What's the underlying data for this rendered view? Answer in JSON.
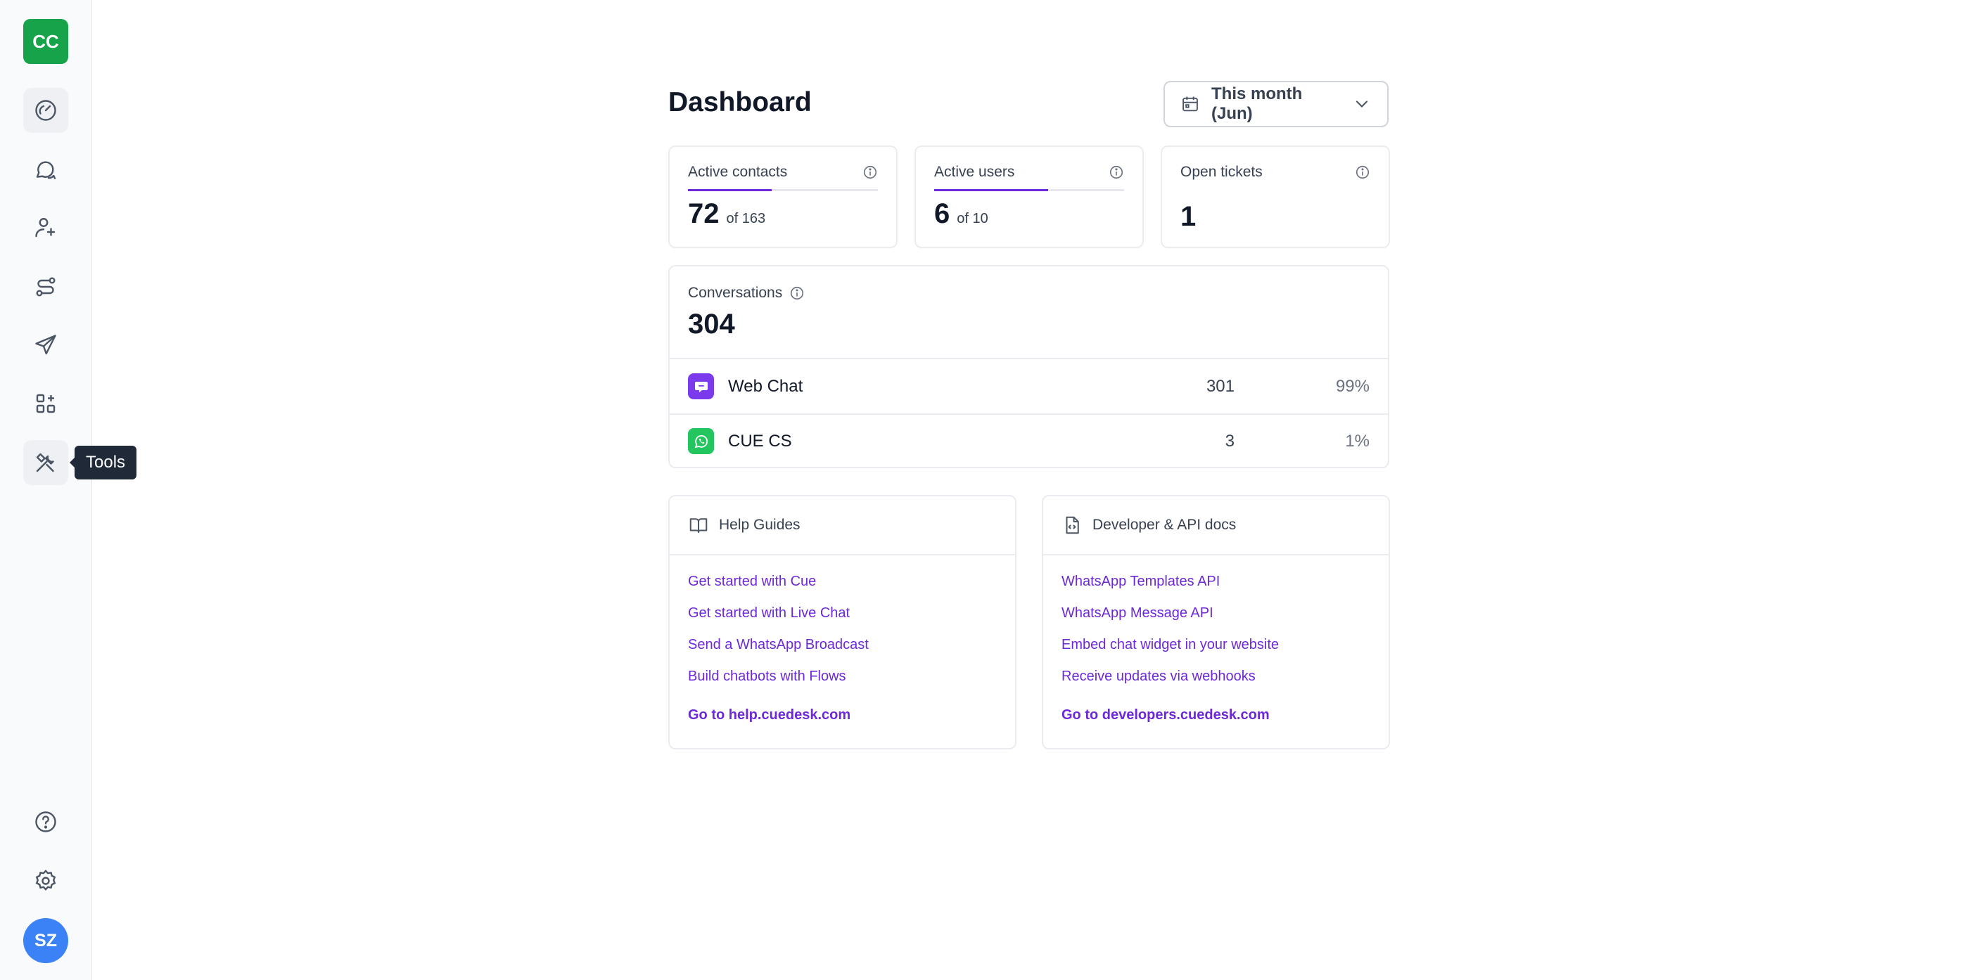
{
  "sidebar": {
    "workspace_initials": "CC",
    "user_initials": "SZ",
    "tooltip": "Tools",
    "items": [
      {
        "name": "dashboard",
        "icon": "gauge-icon"
      },
      {
        "name": "conversations",
        "icon": "chat-bubbles-icon"
      },
      {
        "name": "contacts",
        "icon": "user-sparkle-icon"
      },
      {
        "name": "flows",
        "icon": "route-icon"
      },
      {
        "name": "broadcasts",
        "icon": "send-icon"
      },
      {
        "name": "integrations",
        "icon": "apps-grid-icon"
      },
      {
        "name": "tools",
        "icon": "tools-icon"
      },
      {
        "name": "help",
        "icon": "help-circle-icon"
      },
      {
        "name": "settings",
        "icon": "gear-icon"
      }
    ]
  },
  "header": {
    "title": "Dashboard",
    "date_filter": "This month (Jun)"
  },
  "stats": {
    "active_contacts": {
      "label": "Active contacts",
      "value": "72",
      "total": "of 163",
      "fill_fraction": 0.44
    },
    "active_users": {
      "label": "Active users",
      "value": "6",
      "total": "of 10",
      "fill_fraction": 0.6
    },
    "open_tickets": {
      "label": "Open tickets",
      "value": "1"
    }
  },
  "conversations": {
    "label": "Conversations",
    "total": "304",
    "channels": [
      {
        "name": "Web Chat",
        "count": "301",
        "percent": "99%",
        "color": "#7c3aed"
      },
      {
        "name": "CUE CS",
        "count": "3",
        "percent": "1%",
        "color": "#22c55e"
      }
    ]
  },
  "help_guides": {
    "title": "Help Guides",
    "links": [
      "Get started with Cue",
      "Get started with Live Chat",
      "Send a WhatsApp Broadcast",
      "Build chatbots with Flows"
    ],
    "go": "Go to help.cuedesk.com"
  },
  "dev_docs": {
    "title": "Developer & API docs",
    "links": [
      "WhatsApp Templates API",
      "WhatsApp Message API",
      "Embed chat widget in your website",
      "Receive updates via webhooks"
    ],
    "go": "Go to developers.cuedesk.com"
  },
  "colors": {
    "accent": "#6d28d9",
    "workspace": "#16a34a",
    "avatar": "#3b82f6"
  }
}
